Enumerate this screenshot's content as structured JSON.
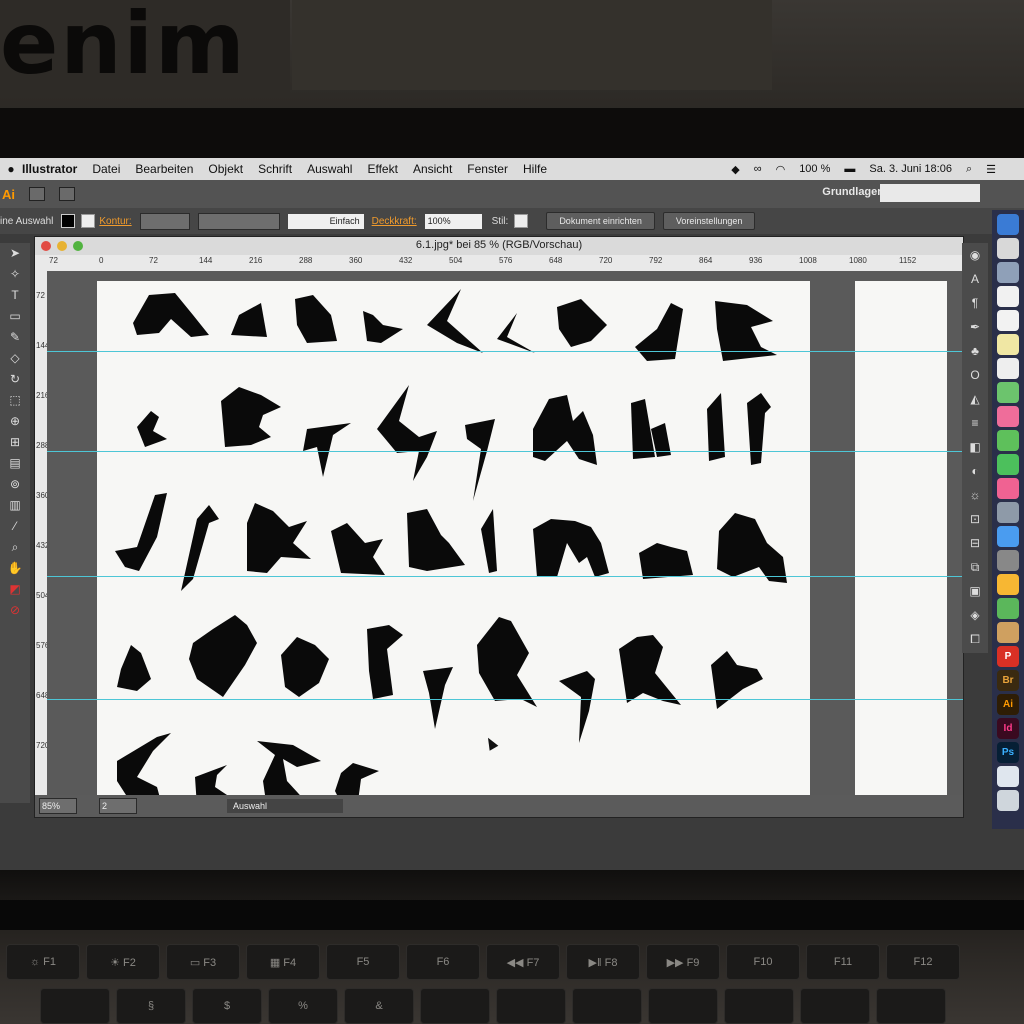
{
  "environment": {
    "poster_text": "enim"
  },
  "menubar": {
    "apple_icon": "apple-logo",
    "app_name": "Illustrator",
    "items": [
      "Datei",
      "Bearbeiten",
      "Objekt",
      "Schrift",
      "Auswahl",
      "Effekt",
      "Ansicht",
      "Fenster",
      "Hilfe"
    ],
    "battery": "100 %",
    "datetime": "Sa. 3. Juni 18:06"
  },
  "app_toolbar": {
    "logo": "Ai",
    "workspace": "Grundlagen"
  },
  "control_bar": {
    "selection_label": "ine Auswahl",
    "stroke_label": "Kontur:",
    "stroke_style": "Einfach",
    "opacity_label": "Deckkraft:",
    "opacity_value": "100%",
    "style_label": "Stil:",
    "doc_setup_button": "Dokument einrichten",
    "preferences_button": "Voreinstellungen"
  },
  "document": {
    "title": "6.1.jpg* bei 85 % (RGB/Vorschau)",
    "ruler_h": [
      "72",
      "0",
      "72",
      "144",
      "216",
      "288",
      "360",
      "432",
      "504",
      "576",
      "648",
      "720",
      "792",
      "864",
      "936",
      "1008",
      "1080",
      "1152"
    ],
    "ruler_v": [
      "72",
      "144",
      "216",
      "288",
      "360",
      "432",
      "504",
      "576",
      "648",
      "720"
    ]
  },
  "status_bar": {
    "zoom": "85%",
    "page": "2",
    "tool": "Auswahl"
  },
  "dock": [
    "P",
    "Br",
    "Ai",
    "Id",
    "Ps"
  ],
  "colors": {
    "accent_orange": "#f19b2c",
    "guide": "#4dc6d6",
    "artboard": "#f7f7f5"
  }
}
